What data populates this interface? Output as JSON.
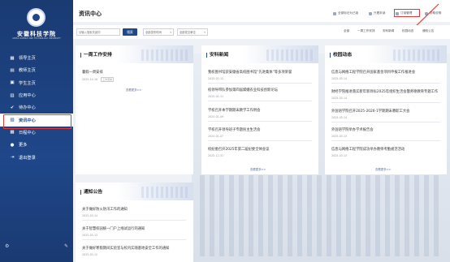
{
  "logo": {
    "name": "安徽科技学院",
    "subtitle": "ANHUI SCIENCE AND TECHNOLOGY UNIVERSITY"
  },
  "sidebar": {
    "items": [
      {
        "label": "领导主页",
        "icon": "grid-icon"
      },
      {
        "label": "教师主页",
        "icon": "teacher-icon"
      },
      {
        "label": "学生主页",
        "icon": "student-icon"
      },
      {
        "label": "应用中心",
        "icon": "apps-icon"
      },
      {
        "label": "待办中心",
        "icon": "check-icon"
      },
      {
        "label": "资讯中心",
        "icon": "news-icon"
      },
      {
        "label": "日程中心",
        "icon": "calendar-icon"
      },
      {
        "label": "更多",
        "icon": "more-icon"
      },
      {
        "label": "退出登录",
        "icon": "logout-icon"
      }
    ],
    "active_index": 5
  },
  "header": {
    "title": "资讯中心",
    "links": [
      "全部标记为已读",
      "只看未读",
      "订阅管理",
      "帮助说明"
    ]
  },
  "filter": {
    "search_placeholder": "请输入搜索关键词",
    "search_label": "搜索",
    "select1": "全部发布时间",
    "select2": "全部发文单位",
    "tabs": [
      "全部",
      "一周工作安排",
      "安科新闻",
      "校园动态",
      "通知公告"
    ]
  },
  "cards": {
    "weekly": {
      "title": "一周工作安排",
      "items": [
        {
          "title": "暑假一周安排",
          "date": "2025-10-18",
          "badge": "工作安排"
        }
      ],
      "more": "查看更多>>"
    },
    "news": {
      "title": "安科新闻",
      "items": [
        {
          "title": "我校图书馆获安徽省高校图书馆“先进集体”等多项荣誉",
          "date": "2025-02-12"
        },
        {
          "title": "校领导带队参加第四届嫦娥农业科技创新论坛",
          "date": "2025-02-11"
        },
        {
          "title": "学校召开本学期期末教学工作例会",
          "date": "2025-01-09"
        },
        {
          "title": "学校召开领导班子专题民主生活会",
          "date": "2025-01-07"
        },
        {
          "title": "校纪委召开2025年第二届纪委全体会议",
          "date": "2025-12-31"
        }
      ],
      "more": "查看更多>>"
    },
    "campus": {
      "title": "校园动态",
      "items": [
        {
          "title": "信息与网络工程学院召开国家基金项目申报工作推进会",
          "date": "2025-03-14"
        },
        {
          "title": "财经学院推进落实新年新目标2025年组织生活会暨师德教育专题工作",
          "date": "2025-03-14"
        },
        {
          "title": "外国语学院召开2025-2026-1学期期末教职工大会",
          "date": "2025-03-14"
        },
        {
          "title": "外国语学院举办学术报告会",
          "date": "2025-03-13"
        },
        {
          "title": "信息与网络工程学院成功举办教师考勤规范活动",
          "date": "2025-03-13"
        }
      ],
      "more": "查看更多>>"
    },
    "notice": {
      "title": "通知公告",
      "items": [
        {
          "title": "关于做好防火防汛工作的通知",
          "date": "2025-03-14"
        },
        {
          "title": "关于智慧校园统一门户上线试运行的通知",
          "date": "2025-03-13"
        },
        {
          "title": "关于做好寒假期间实验室与校内实践基地安全工作的通知",
          "date": "2025-03-12"
        }
      ]
    }
  },
  "colors": {
    "brand": "#1f4789",
    "highlight": "#e53935"
  }
}
